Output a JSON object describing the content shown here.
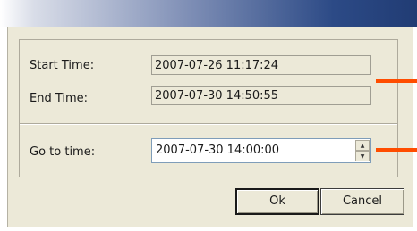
{
  "dialog": {
    "start_label": "Start Time:",
    "start_value": "2007-07-26 11:17:24",
    "end_label": "End Time:",
    "end_value": "2007-07-30 14:50:55",
    "goto_label": "Go to time:",
    "goto_value": "2007-07-30 14:00:00",
    "ok_label": "Ok",
    "cancel_label": "Cancel"
  },
  "colors": {
    "dialog_bg": "#ece9d8",
    "title_gradient_end": "#213c74",
    "annotation_marker": "#ff4d00"
  },
  "icons": {
    "spin_up": "up-arrow-icon",
    "spin_down": "down-arrow-icon"
  }
}
